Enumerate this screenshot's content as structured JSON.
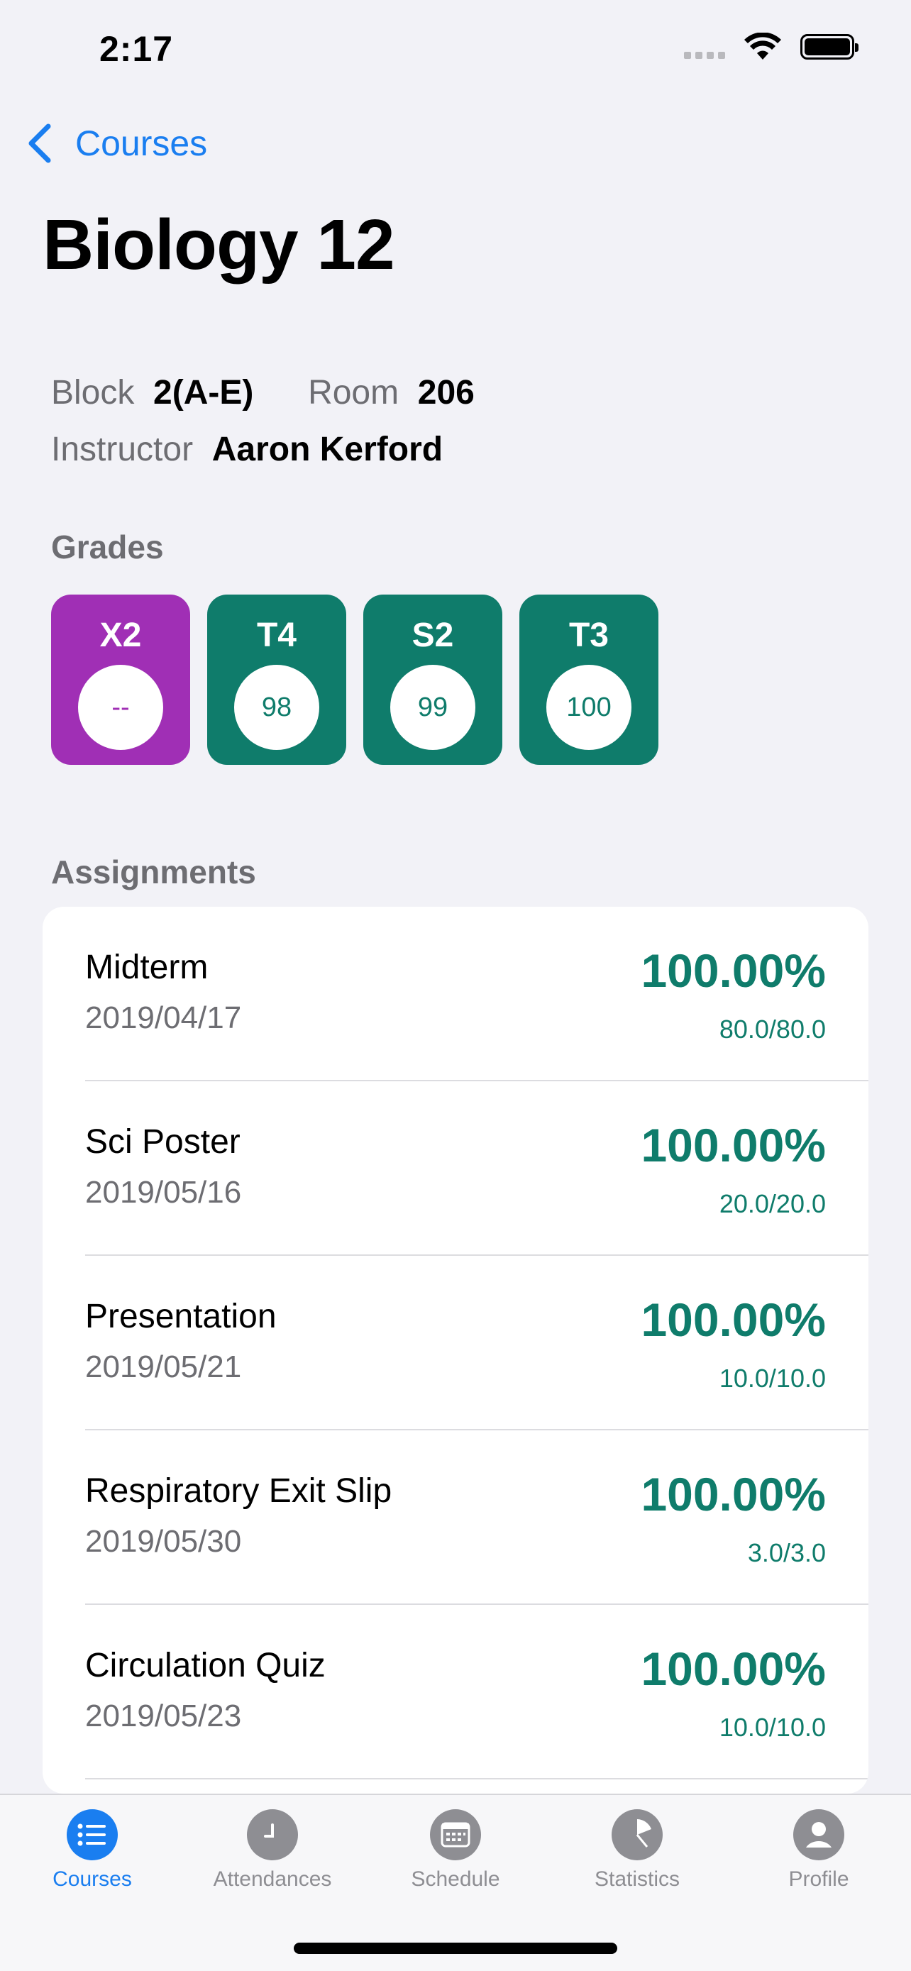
{
  "status": {
    "time": "2:17"
  },
  "nav": {
    "back_label": "Courses",
    "title": "Biology 12"
  },
  "info": {
    "block_label": "Block",
    "block_value": "2(A-E)",
    "room_label": "Room",
    "room_value": "206",
    "instructor_label": "Instructor",
    "instructor_value": "Aaron Kerford"
  },
  "grades": {
    "header": "Grades",
    "items": [
      {
        "label": "X2",
        "value": "--",
        "color": "#a02fb5"
      },
      {
        "label": "T4",
        "value": "98",
        "color": "#0f7c6b"
      },
      {
        "label": "S2",
        "value": "99",
        "color": "#0f7c6b"
      },
      {
        "label": "T3",
        "value": "100",
        "color": "#0f7c6b"
      }
    ]
  },
  "assignments": {
    "header": "Assignments",
    "items": [
      {
        "name": "Midterm",
        "date": "2019/04/17",
        "percent": "100.00%",
        "score": "80.0/80.0"
      },
      {
        "name": "Sci Poster",
        "date": "2019/05/16",
        "percent": "100.00%",
        "score": "20.0/20.0"
      },
      {
        "name": "Presentation",
        "date": "2019/05/21",
        "percent": "100.00%",
        "score": "10.0/10.0"
      },
      {
        "name": "Respiratory Exit Slip",
        "date": "2019/05/30",
        "percent": "100.00%",
        "score": "3.0/3.0"
      },
      {
        "name": "Circulation Quiz",
        "date": "2019/05/23",
        "percent": "100.00%",
        "score": "10.0/10.0"
      }
    ]
  },
  "tabs": [
    {
      "label": "Courses",
      "icon": "list-icon",
      "active": true
    },
    {
      "label": "Attendances",
      "icon": "clock-icon",
      "active": false
    },
    {
      "label": "Schedule",
      "icon": "calendar-icon",
      "active": false
    },
    {
      "label": "Statistics",
      "icon": "pie-chart-icon",
      "active": false
    },
    {
      "label": "Profile",
      "icon": "person-icon",
      "active": false
    }
  ],
  "colors": {
    "accent": "#1a7ef0",
    "grade_green": "#0f7c6b",
    "grade_purple": "#a02fb5"
  }
}
